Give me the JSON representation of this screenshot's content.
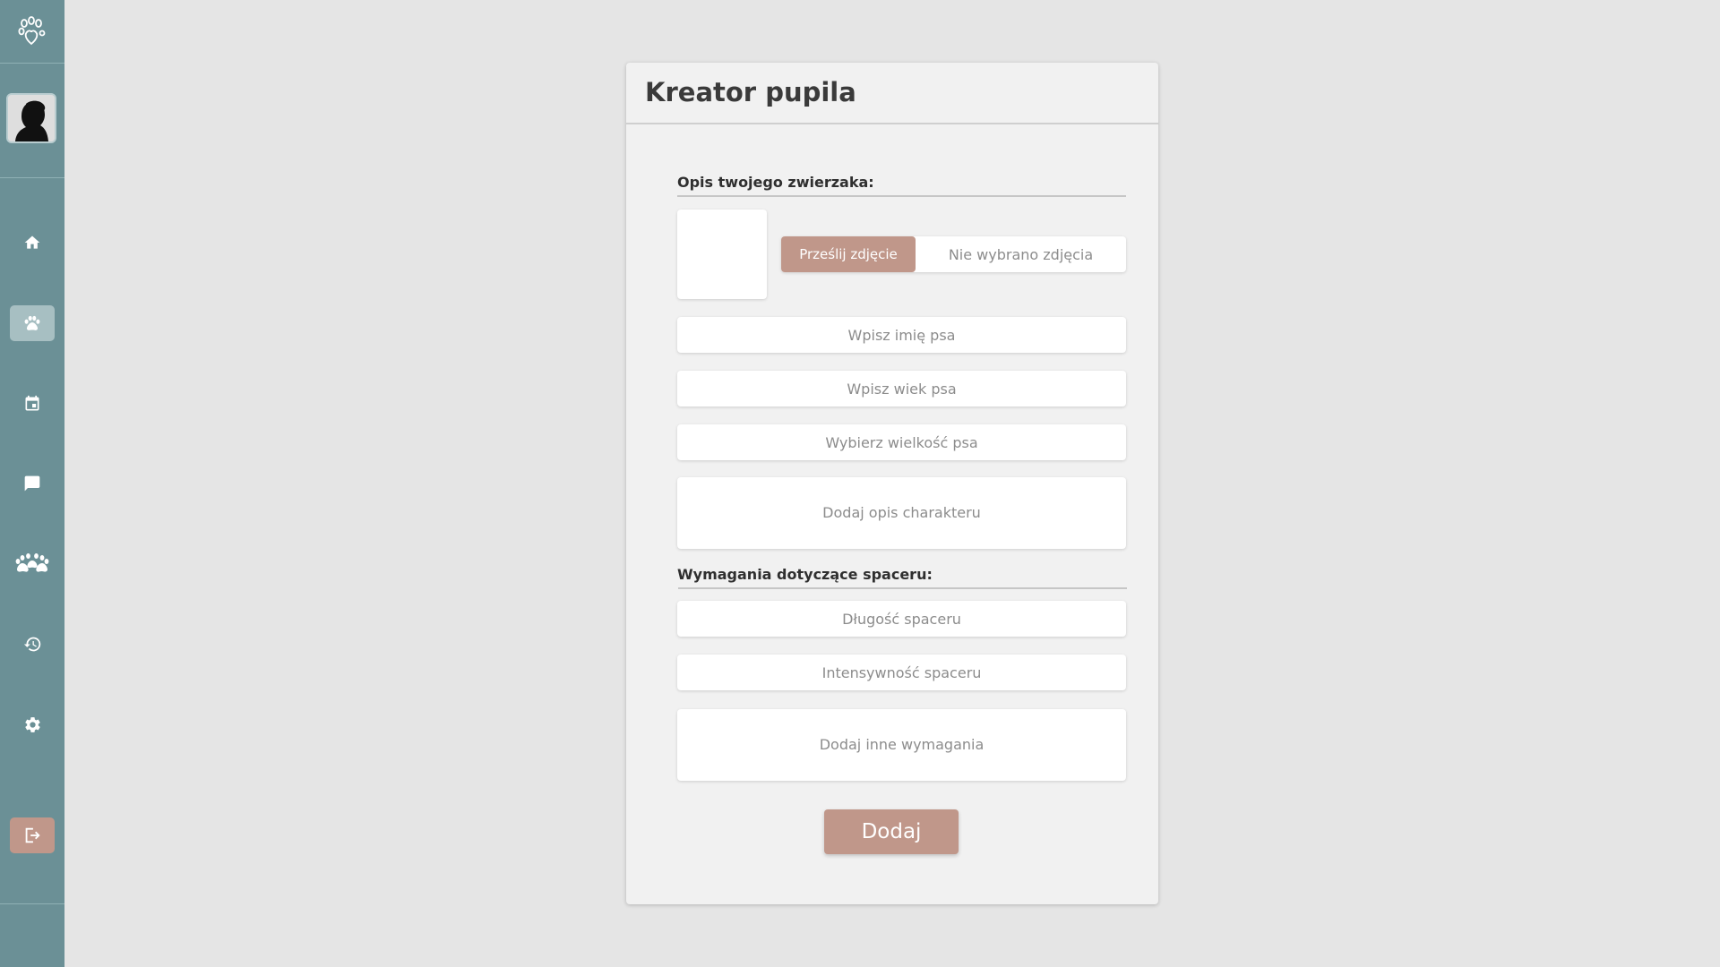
{
  "app": {
    "brand_color": "#6b9096",
    "accent_color": "#c0978a",
    "logo_icon": "paw-heart-icon"
  },
  "sidebar": {
    "items": [
      {
        "name": "home",
        "icon": "home-icon",
        "active": false
      },
      {
        "name": "pets",
        "icon": "paw-icon",
        "active": true
      },
      {
        "name": "calendar",
        "icon": "calendar-icon",
        "active": false
      },
      {
        "name": "messages",
        "icon": "chat-icon",
        "active": false
      },
      {
        "name": "community",
        "icon": "paws-group-icon",
        "active": false
      },
      {
        "name": "history",
        "icon": "history-icon",
        "active": false
      },
      {
        "name": "settings",
        "icon": "gear-icon",
        "active": false
      }
    ],
    "logout_icon": "logout-icon"
  },
  "form": {
    "title": "Kreator pupila",
    "description_section": "Opis twojego zwierzaka:",
    "upload_button": "Prześlij zdjęcie",
    "upload_status": "Nie wybrano zdjęcia",
    "name_placeholder": "Wpisz imię psa",
    "age_placeholder": "Wpisz wiek psa",
    "size_placeholder": "Wybierz wielkość psa",
    "character_placeholder": "Dodaj opis charakteru",
    "walk_section": "Wymagania dotyczące spaceru:",
    "walk_length_placeholder": "Długość spaceru",
    "walk_intensity_placeholder": "Intensywność spaceru",
    "other_requirements_placeholder": "Dodaj inne wymagania",
    "submit_button": "Dodaj"
  }
}
